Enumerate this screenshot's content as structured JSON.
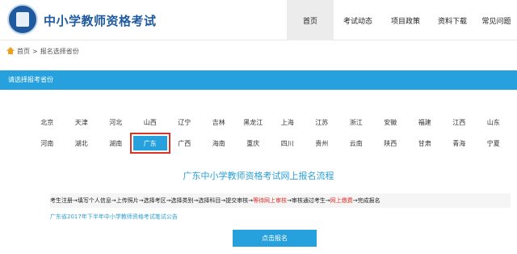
{
  "header": {
    "site_title": "中小学教师资格考试",
    "nav": [
      {
        "label": "首页",
        "active": true
      },
      {
        "label": "考试动态",
        "active": false
      },
      {
        "label": "项目政策",
        "active": false
      },
      {
        "label": "资料下载",
        "active": false
      },
      {
        "label": "常见问题",
        "active": false
      }
    ]
  },
  "breadcrumb": {
    "home": "首页",
    "separator": ">",
    "current": "报名选择省份"
  },
  "section_bar": {
    "label": "请选择报考省份"
  },
  "provinces": {
    "row1": [
      "北京",
      "天津",
      "河北",
      "山西",
      "辽宁",
      "吉林",
      "黑龙江",
      "上海",
      "江苏",
      "浙江",
      "安徽",
      "福建",
      "江西",
      "山东"
    ],
    "row2": [
      "河南",
      "湖北",
      "湖南",
      "广东",
      "广西",
      "海南",
      "重庆",
      "四川",
      "贵州",
      "云南",
      "陕西",
      "甘肃",
      "青海",
      "宁夏"
    ],
    "selected": "广东"
  },
  "flow": {
    "title": "广东中小学教师资格考试网上报名流程",
    "part1": "考生注册→填写个人信息→上传照片→选择考区→选择类别→选择科目→提交审核→",
    "part2_red": "等待网上审核",
    "part3": "→审核通过考生→",
    "part4_red": "网上缴费",
    "part5": "→完成报名"
  },
  "notice": {
    "link": "广东省2017年下半年中小学教师资格考试笔试公告"
  },
  "signup": {
    "button": "点击报名"
  },
  "colors": {
    "accent": "#27a1de",
    "brand": "#1f5a9e",
    "highlight_red": "#e0302a",
    "selection_border": "#d9332a"
  }
}
